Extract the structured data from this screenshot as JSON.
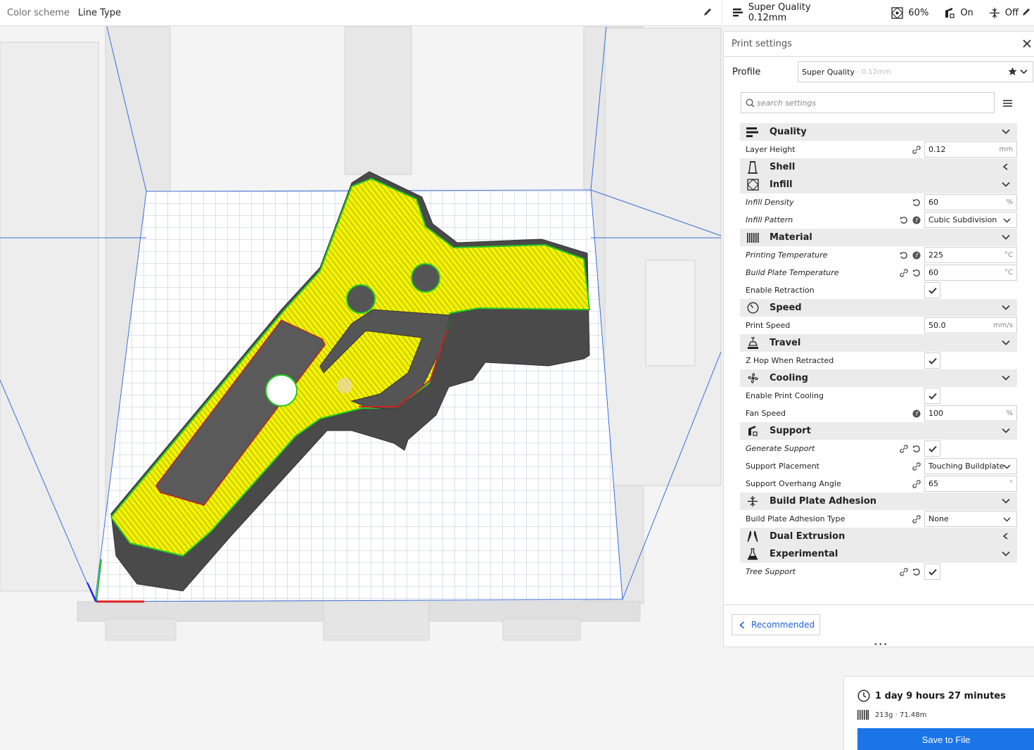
{
  "topbar_left": {
    "color_scheme_label": "Color scheme",
    "color_scheme_value": "Line Type"
  },
  "topbar_right": {
    "profile": "Super Quality 0.12mm",
    "infill": "60%",
    "support": "On",
    "adhesion": "Off"
  },
  "panel": {
    "title": "Print settings",
    "profile_label": "Profile",
    "profile_name": "Super Quality",
    "profile_suffix": " - 0.12mm",
    "search_placeholder": "search settings"
  },
  "categories": {
    "quality": "Quality",
    "shell": "Shell",
    "infill": "Infill",
    "material": "Material",
    "speed": "Speed",
    "travel": "Travel",
    "cooling": "Cooling",
    "support": "Support",
    "adhesion": "Build Plate Adhesion",
    "dual": "Dual Extrusion",
    "experimental": "Experimental"
  },
  "settings": {
    "layer_height": {
      "label": "Layer Height",
      "value": "0.12",
      "unit": "mm"
    },
    "infill_density": {
      "label": "Infill Density",
      "value": "60",
      "unit": "%"
    },
    "infill_pattern": {
      "label": "Infill Pattern",
      "value": "Cubic Subdivision"
    },
    "print_temp": {
      "label": "Printing Temperature",
      "value": "225",
      "unit": "°C"
    },
    "bed_temp": {
      "label": "Build Plate Temperature",
      "value": "60",
      "unit": "°C"
    },
    "enable_retraction": {
      "label": "Enable Retraction"
    },
    "print_speed": {
      "label": "Print Speed",
      "value": "50.0",
      "unit": "mm/s"
    },
    "z_hop": {
      "label": "Z Hop When Retracted"
    },
    "enable_cooling": {
      "label": "Enable Print Cooling"
    },
    "fan_speed": {
      "label": "Fan Speed",
      "value": "100",
      "unit": "%"
    },
    "generate_support": {
      "label": "Generate Support"
    },
    "support_placement": {
      "label": "Support Placement",
      "value": "Touching Buildplate"
    },
    "overhang_angle": {
      "label": "Support Overhang Angle",
      "value": "65",
      "unit": "°"
    },
    "adhesion_type": {
      "label": "Build Plate Adhesion Type",
      "value": "None"
    },
    "tree_support": {
      "label": "Tree Support"
    }
  },
  "recommended_label": "Recommended",
  "estimate": {
    "time": "1 day 9 hours 27 minutes",
    "material": "213g · 71.48m",
    "save_label": "Save to File"
  },
  "colors": {
    "accent": "#1b74e8",
    "model_fill": "#f0f000",
    "model_wall": "#4a4a4a",
    "outline_green": "#22cc22"
  }
}
